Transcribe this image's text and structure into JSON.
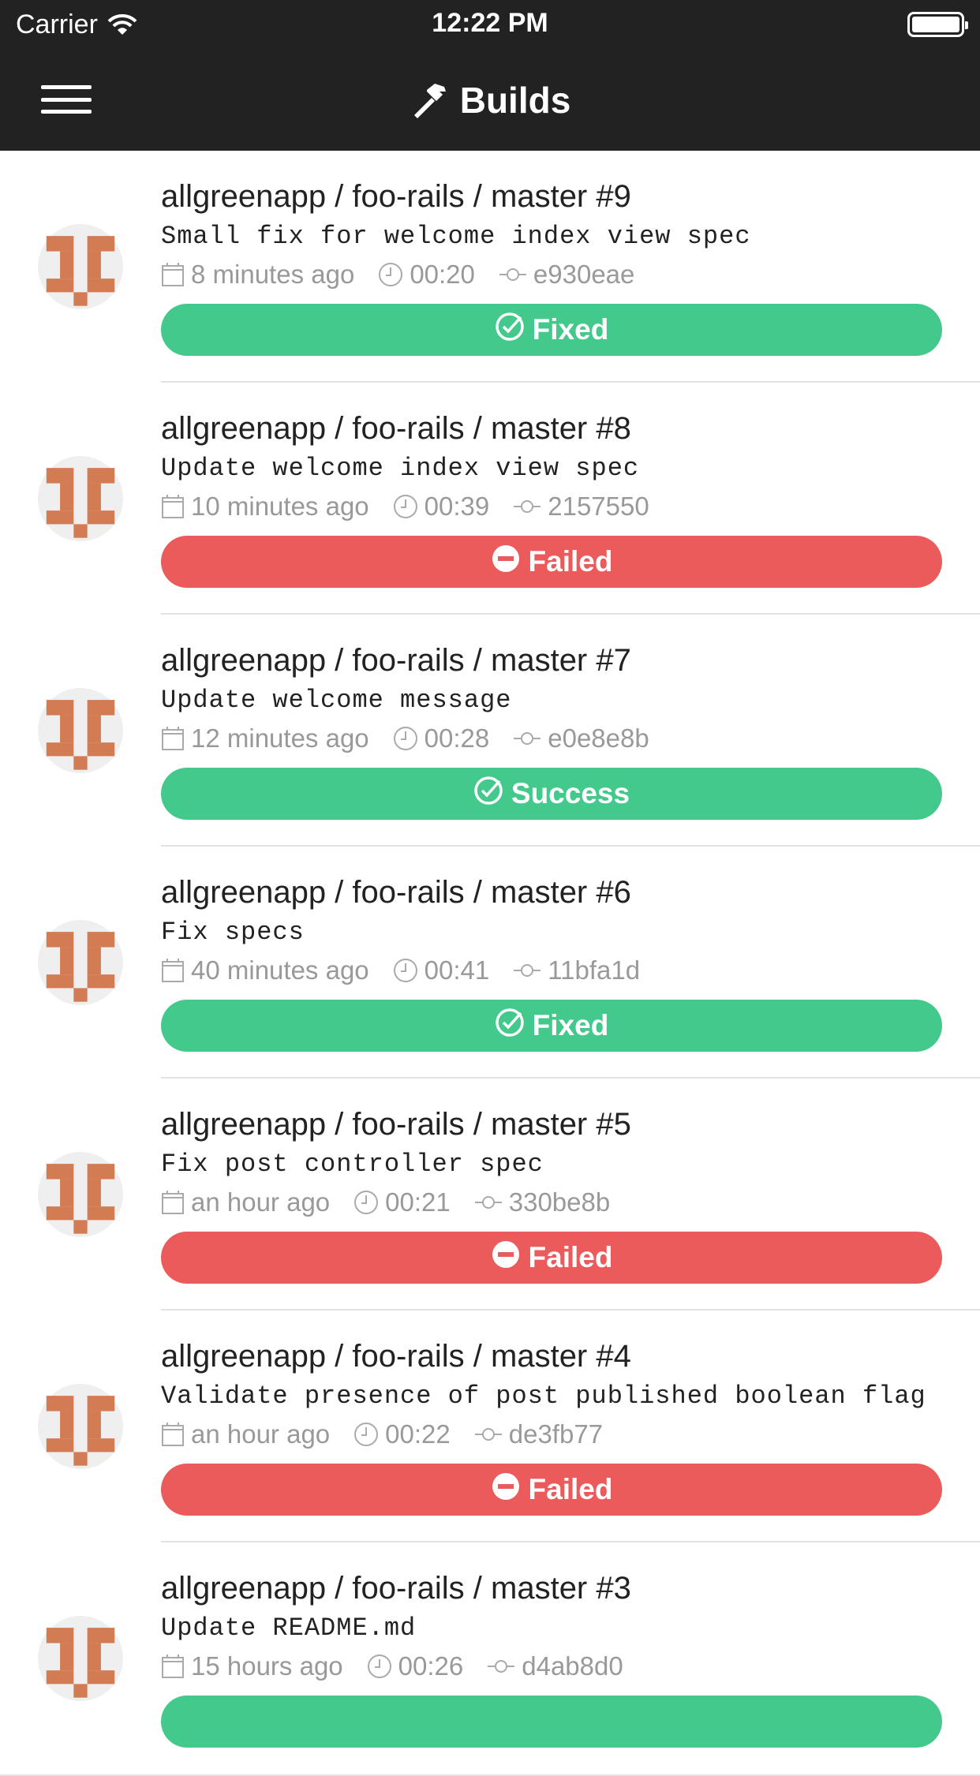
{
  "status_bar": {
    "carrier": "Carrier",
    "time": "12:22 PM",
    "battery_level": 100
  },
  "header": {
    "title": "Builds",
    "icon": "hammer-icon",
    "menu_icon": "hamburger-icon"
  },
  "colors": {
    "success": "#44c98c",
    "failed": "#ec5b5b",
    "nav": "#222222",
    "avatar": "#d37b52"
  },
  "builds": [
    {
      "title": "allgreenapp / foo-rails / master #9",
      "message": "Small fix for welcome index view spec",
      "time_ago": "8 minutes ago",
      "duration": "00:20",
      "commit": "e930eae",
      "status": "Fixed",
      "state": "success"
    },
    {
      "title": "allgreenapp / foo-rails / master #8",
      "message": "Update welcome index view spec",
      "time_ago": "10 minutes ago",
      "duration": "00:39",
      "commit": "2157550",
      "status": "Failed",
      "state": "failed"
    },
    {
      "title": "allgreenapp / foo-rails / master #7",
      "message": "Update welcome message",
      "time_ago": "12 minutes ago",
      "duration": "00:28",
      "commit": "e0e8e8b",
      "status": "Success",
      "state": "success"
    },
    {
      "title": "allgreenapp / foo-rails / master #6",
      "message": "Fix specs",
      "time_ago": "40 minutes ago",
      "duration": "00:41",
      "commit": "11bfa1d",
      "status": "Fixed",
      "state": "success"
    },
    {
      "title": "allgreenapp / foo-rails / master #5",
      "message": "Fix post controller spec",
      "time_ago": "an hour ago",
      "duration": "00:21",
      "commit": "330be8b",
      "status": "Failed",
      "state": "failed"
    },
    {
      "title": "allgreenapp / foo-rails / master #4",
      "message": "Validate presence of post published boolean flag",
      "time_ago": "an hour ago",
      "duration": "00:22",
      "commit": "de3fb77",
      "status": "Failed",
      "state": "failed"
    },
    {
      "title": "allgreenapp / foo-rails / master #3",
      "message": "Update README.md",
      "time_ago": "15 hours ago",
      "duration": "00:26",
      "commit": "d4ab8d0",
      "status": "",
      "state": "success"
    }
  ]
}
